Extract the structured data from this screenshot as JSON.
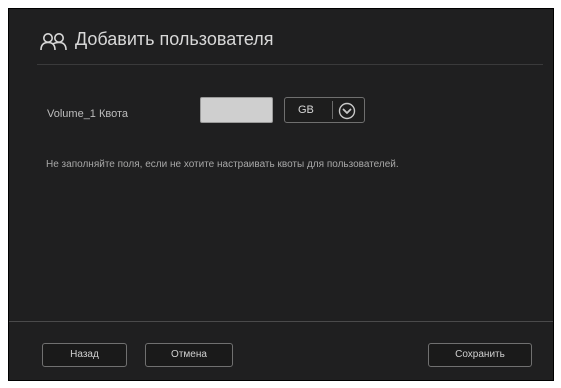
{
  "dialog": {
    "title": "Добавить пользователя",
    "title_icon": "users-icon"
  },
  "quota": {
    "label": "Volume_1 Квота",
    "value": "",
    "unit": "GB",
    "unit_icon": "chevron-down-circle-icon"
  },
  "hint": "Не заполняйте поля, если не хотите настраивать квоты для пользователей.",
  "buttons": {
    "back": "Назад",
    "cancel": "Отмена",
    "save": "Сохранить"
  }
}
